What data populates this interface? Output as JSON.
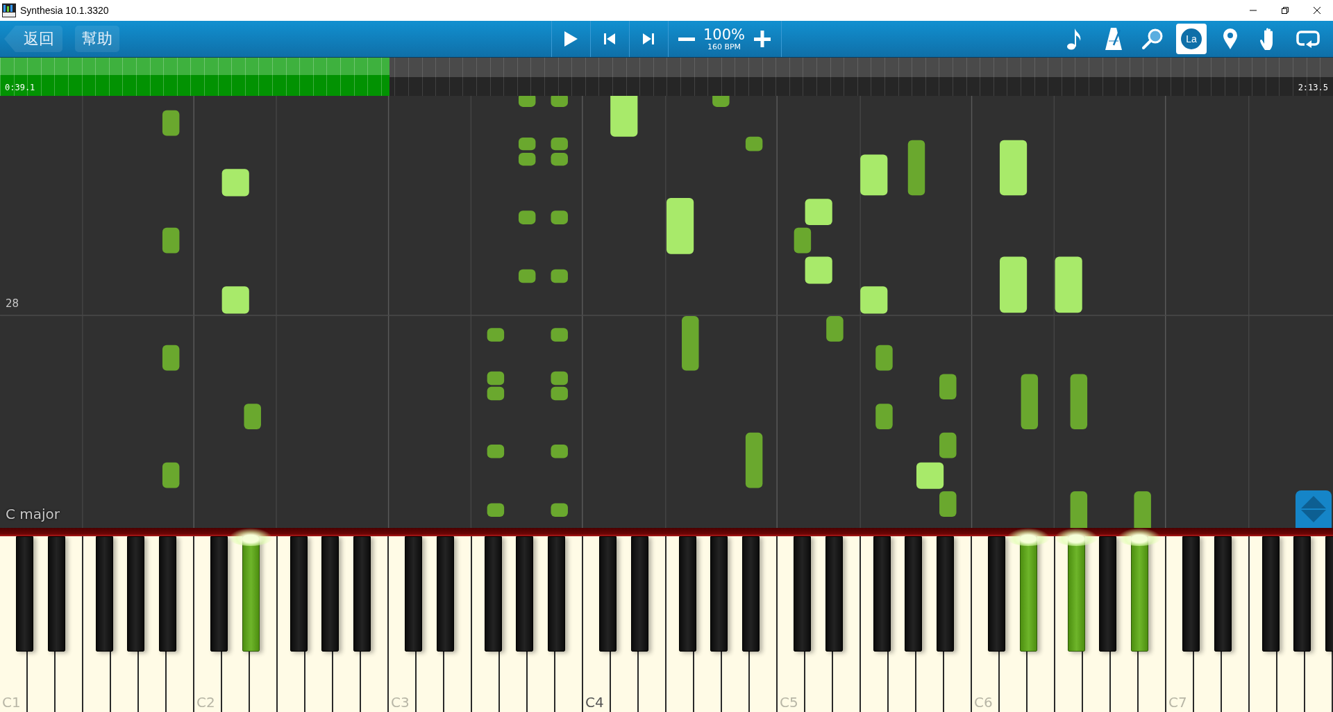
{
  "window": {
    "title": "Synthesia 10.1.3320"
  },
  "toolbar": {
    "back_button": "返回",
    "help_button": "幫助",
    "playback": [
      {
        "kind": "play"
      },
      {
        "kind": "previous"
      },
      {
        "kind": "next"
      }
    ],
    "speed": {
      "percent": "100%",
      "tempo": "160 BPM"
    },
    "tools": [
      {
        "kind": "note",
        "active": false
      },
      {
        "kind": "metronome",
        "active": false
      },
      {
        "kind": "search",
        "active": false
      },
      {
        "kind": "label",
        "text": "La",
        "active": true
      },
      {
        "kind": "pin",
        "active": false
      },
      {
        "kind": "hand",
        "active": false
      },
      {
        "kind": "loop",
        "active": false
      }
    ]
  },
  "timeline": {
    "elapsed": "0:39.1",
    "total": "2:13.5",
    "level": 0.292
  },
  "notes_area": {
    "measure_number": "28",
    "key_signature": "C major"
  },
  "keyboard": {
    "octaves": [
      {
        "label": "C1",
        "highlighted": false,
        "black_keys": [
          {
            "pressed": false
          },
          {
            "pressed": false
          },
          {
            "pressed": false
          },
          {
            "pressed": false
          },
          {
            "pressed": false
          }
        ]
      },
      {
        "label": "C2",
        "highlighted": false,
        "black_keys": [
          {
            "pressed": false
          },
          {
            "pressed": true
          },
          {
            "pressed": false
          },
          {
            "pressed": false
          },
          {
            "pressed": false
          }
        ]
      },
      {
        "label": "C3",
        "highlighted": false,
        "black_keys": [
          {
            "pressed": false
          },
          {
            "pressed": false
          },
          {
            "pressed": false
          },
          {
            "pressed": false
          },
          {
            "pressed": false
          }
        ]
      },
      {
        "label": "C4",
        "highlighted": true,
        "black_keys": [
          {
            "pressed": false
          },
          {
            "pressed": false
          },
          {
            "pressed": false
          },
          {
            "pressed": false
          },
          {
            "pressed": false
          }
        ]
      },
      {
        "label": "C5",
        "highlighted": false,
        "black_keys": [
          {
            "pressed": false
          },
          {
            "pressed": false
          },
          {
            "pressed": false
          },
          {
            "pressed": false
          },
          {
            "pressed": false
          }
        ]
      },
      {
        "label": "C6",
        "highlighted": false,
        "black_keys": [
          {
            "pressed": false
          },
          {
            "pressed": true
          },
          {
            "pressed": true
          },
          {
            "pressed": false
          },
          {
            "pressed": true
          }
        ]
      },
      {
        "label": "C7",
        "highlighted": false,
        "black_keys": [
          {
            "pressed": false
          },
          {
            "pressed": false
          },
          {
            "pressed": false
          },
          {
            "pressed": false
          },
          {
            "pressed": false
          }
        ]
      }
    ]
  }
}
